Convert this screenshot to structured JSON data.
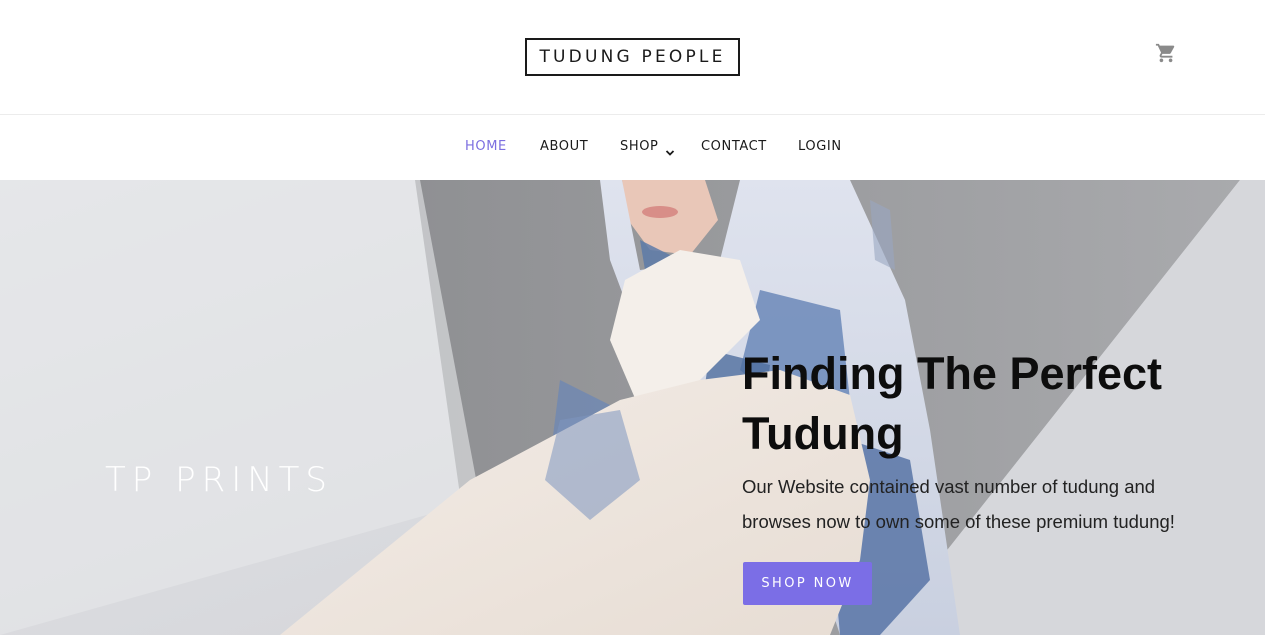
{
  "header": {
    "logo_text": "TUDUNG PEOPLE",
    "cart_icon": "shopping-cart-icon"
  },
  "nav": {
    "items": [
      {
        "label": "HOME",
        "active": true
      },
      {
        "label": "ABOUT",
        "active": false
      },
      {
        "label": "SHOP",
        "active": false,
        "has_dropdown": true
      },
      {
        "label": "CONTACT",
        "active": false
      },
      {
        "label": "LOGIN",
        "active": false
      }
    ],
    "dropdown_icon": "chevron-down-icon"
  },
  "hero": {
    "badge_text": "TP PRINTS",
    "title": "Finding The Perfect Tudung",
    "description": "Our Website contained vast number of tudung and browses now to own some of these premium tudung!",
    "cta_label": "SHOP NOW"
  },
  "colors": {
    "accent": "#7b6ee6",
    "active_nav": "#7c6fe0",
    "text_dark": "#1a1a1a"
  }
}
